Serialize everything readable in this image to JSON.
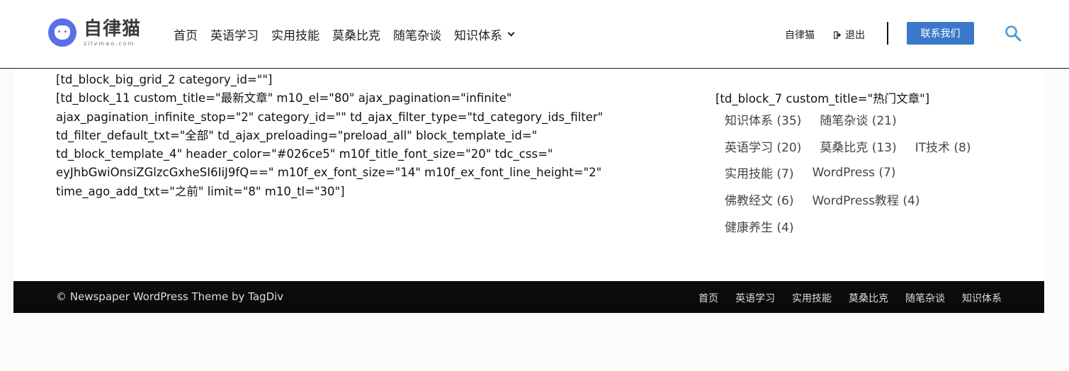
{
  "header": {
    "logo_cn": "自律猫",
    "logo_en": "zilvmao.com",
    "nav": [
      "首页",
      "英语学习",
      "实用技能",
      "莫桑比克",
      "随笔杂谈",
      "知识体系"
    ],
    "user": "自律猫",
    "logout": "退出",
    "contact": "联系我们",
    "accent_color": "#3b78c9"
  },
  "main": {
    "shortcode_lines": [
      "[td_block_big_grid_2 category_id=\"\"]",
      "[td_block_11 custom_title=\"最新文章\" m10_el=\"80\" ajax_pagination=\"infinite\"",
      "ajax_pagination_infinite_stop=\"2\" category_id=\"\" td_ajax_filter_type=\"td_category_ids_filter\"",
      "td_filter_default_txt=\"全部\" td_ajax_preloading=\"preload_all\" block_template_id=\"",
      "td_block_template_4\" header_color=\"#026ce5\" m10f_title_font_size=\"20\" tdc_css=\"",
      "eyJhbGwiOnsiZGlzcGxheSI6IiJ9fQ==\" m10f_ex_font_size=\"14\" m10f_ex_font_line_height=\"2\"",
      "time_ago_add_txt=\"之前\" limit=\"8\" m10_tl=\"30\"]"
    ]
  },
  "sidebar": {
    "shortcode": "[td_block_7 custom_title=\"热门文章\"]",
    "tag_rows": [
      [
        "知识体系 (35)",
        "随笔杂谈 (21)"
      ],
      [
        "英语学习 (20)",
        "莫桑比克 (13)",
        "IT技术 (8)"
      ],
      [
        "实用技能 (7)",
        "WordPress (7)"
      ],
      [
        "佛教经文 (6)",
        "WordPress教程 (4)"
      ],
      [
        "健康养生 (4)"
      ]
    ]
  },
  "footer": {
    "copyright": "© Newspaper WordPress Theme by TagDiv",
    "nav": [
      "首页",
      "英语学习",
      "实用技能",
      "莫桑比克",
      "随笔杂谈",
      "知识体系"
    ]
  }
}
